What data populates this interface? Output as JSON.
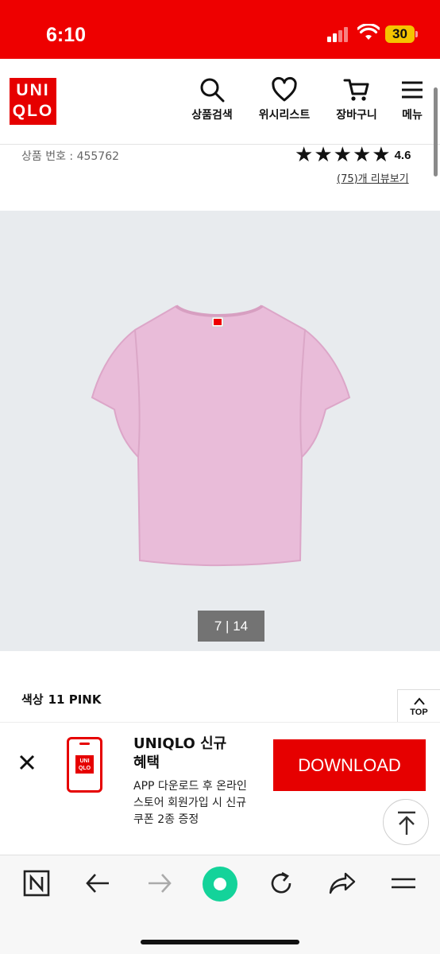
{
  "status_bar": {
    "time": "6:10",
    "battery": "30"
  },
  "header": {
    "logo_line1": "UNI",
    "logo_line2": "QLO",
    "nav": [
      {
        "label": "상품검색",
        "icon": "search-icon"
      },
      {
        "label": "위시리스트",
        "icon": "heart-icon"
      },
      {
        "label": "장바구니",
        "icon": "cart-icon"
      },
      {
        "label": "메뉴",
        "icon": "menu-icon"
      }
    ]
  },
  "product": {
    "number_text": "상품 번호 : 455762",
    "rating": "4.6",
    "stars_count": 5,
    "review_link": "(75)개 리뷰보기",
    "image_counter": "7 | 14",
    "color_label": "색상",
    "color_value": "11 PINK",
    "shirt_color": "#e9bcd9"
  },
  "top_button": {
    "label": "TOP"
  },
  "app_banner": {
    "title": "UNIQLO 신규 혜택",
    "description": "APP 다운로드 후 온라인 스토어 회원가입 시 신규 쿠폰 2종 증정",
    "download_label": "DOWNLOAD",
    "icon_text_line1": "UNI",
    "icon_text_line2": "QLO"
  },
  "colors": {
    "brand": "#e60000",
    "status_bar": "#ee0000",
    "image_bg": "#e8ebee"
  },
  "browser_toolbar": [
    "naver-icon",
    "back-arrow-icon",
    "forward-arrow-icon",
    "green-dot-icon",
    "refresh-icon",
    "share-icon",
    "hamburger-icon"
  ]
}
